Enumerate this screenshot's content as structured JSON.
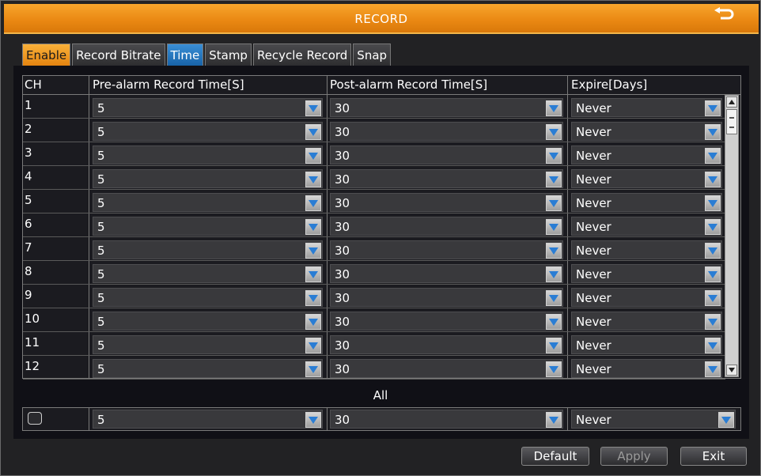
{
  "window": {
    "title": "RECORD",
    "back_icon": "return-arrow-icon"
  },
  "tabs": [
    {
      "label": "Enable"
    },
    {
      "label": "Record Bitrate"
    },
    {
      "label": "Time"
    },
    {
      "label": "Stamp"
    },
    {
      "label": "Recycle Record"
    },
    {
      "label": "Snap"
    }
  ],
  "active_tab": "Time",
  "table": {
    "headers": [
      "CH",
      "Pre-alarm Record Time[S]",
      "Post-alarm Record Time[S]",
      "Expire[Days]"
    ],
    "rows": [
      {
        "ch": "1",
        "pre": "5",
        "post": "30",
        "expire": "Never"
      },
      {
        "ch": "2",
        "pre": "5",
        "post": "30",
        "expire": "Never"
      },
      {
        "ch": "3",
        "pre": "5",
        "post": "30",
        "expire": "Never"
      },
      {
        "ch": "4",
        "pre": "5",
        "post": "30",
        "expire": "Never"
      },
      {
        "ch": "5",
        "pre": "5",
        "post": "30",
        "expire": "Never"
      },
      {
        "ch": "6",
        "pre": "5",
        "post": "30",
        "expire": "Never"
      },
      {
        "ch": "7",
        "pre": "5",
        "post": "30",
        "expire": "Never"
      },
      {
        "ch": "8",
        "pre": "5",
        "post": "30",
        "expire": "Never"
      },
      {
        "ch": "9",
        "pre": "5",
        "post": "30",
        "expire": "Never"
      },
      {
        "ch": "10",
        "pre": "5",
        "post": "30",
        "expire": "Never"
      },
      {
        "ch": "11",
        "pre": "5",
        "post": "30",
        "expire": "Never"
      },
      {
        "ch": "12",
        "pre": "5",
        "post": "30",
        "expire": "Never"
      }
    ]
  },
  "all": {
    "label": "All",
    "checked": false,
    "pre": "5",
    "post": "30",
    "expire": "Never"
  },
  "buttons": {
    "default": "Default",
    "apply": "Apply",
    "exit": "Exit"
  },
  "colors": {
    "title_bar": "#e98712",
    "enable_tab": "#f9b13a",
    "active_tab": "#1863a8",
    "arrow": "#2a7dd4"
  }
}
